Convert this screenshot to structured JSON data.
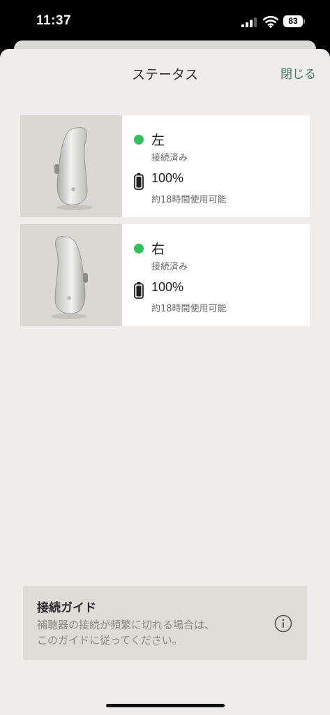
{
  "status_bar": {
    "time": "11:37",
    "battery": "83"
  },
  "header": {
    "title": "ステータス",
    "close_label": "閉じる"
  },
  "devices": [
    {
      "side": "左",
      "connection": "接続済み",
      "battery_percent": "100%",
      "battery_hours": "約18時間使用可能",
      "status_color": "#2ec25c"
    },
    {
      "side": "右",
      "connection": "接続済み",
      "battery_percent": "100%",
      "battery_hours": "約18時間使用可能",
      "status_color": "#2ec25c"
    }
  ],
  "guide": {
    "title": "接続ガイド",
    "line1": "補聴器の接続が頻繁に切れる場合は、",
    "line2": "このガイドに従ってください。"
  },
  "icons": [
    "signal-icon",
    "wifi-icon",
    "battery-icon",
    "hearing-aid-image",
    "battery-full-icon",
    "info-icon"
  ],
  "colors": {
    "accent": "#3f7a60",
    "connected": "#2ec25c"
  }
}
